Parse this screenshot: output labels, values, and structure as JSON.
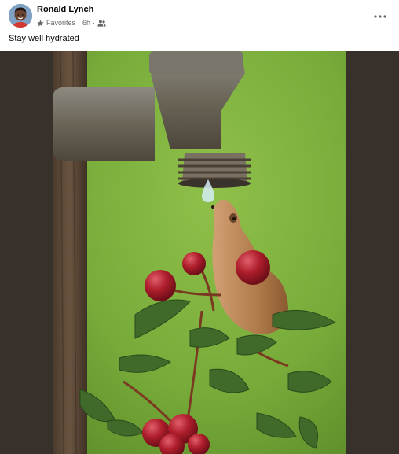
{
  "post": {
    "author": "Ronald Lynch",
    "audience": "Favorites",
    "time": "6h",
    "separator": "·",
    "text": "Stay well hydrated"
  },
  "icons": {
    "audience": "star-icon",
    "visibility": "friends-icon",
    "menu": "more-options-icon"
  },
  "colors": {
    "background": "#ffffff",
    "name": "#050505",
    "meta": "#65676b",
    "photo_frame": "#38302b"
  }
}
